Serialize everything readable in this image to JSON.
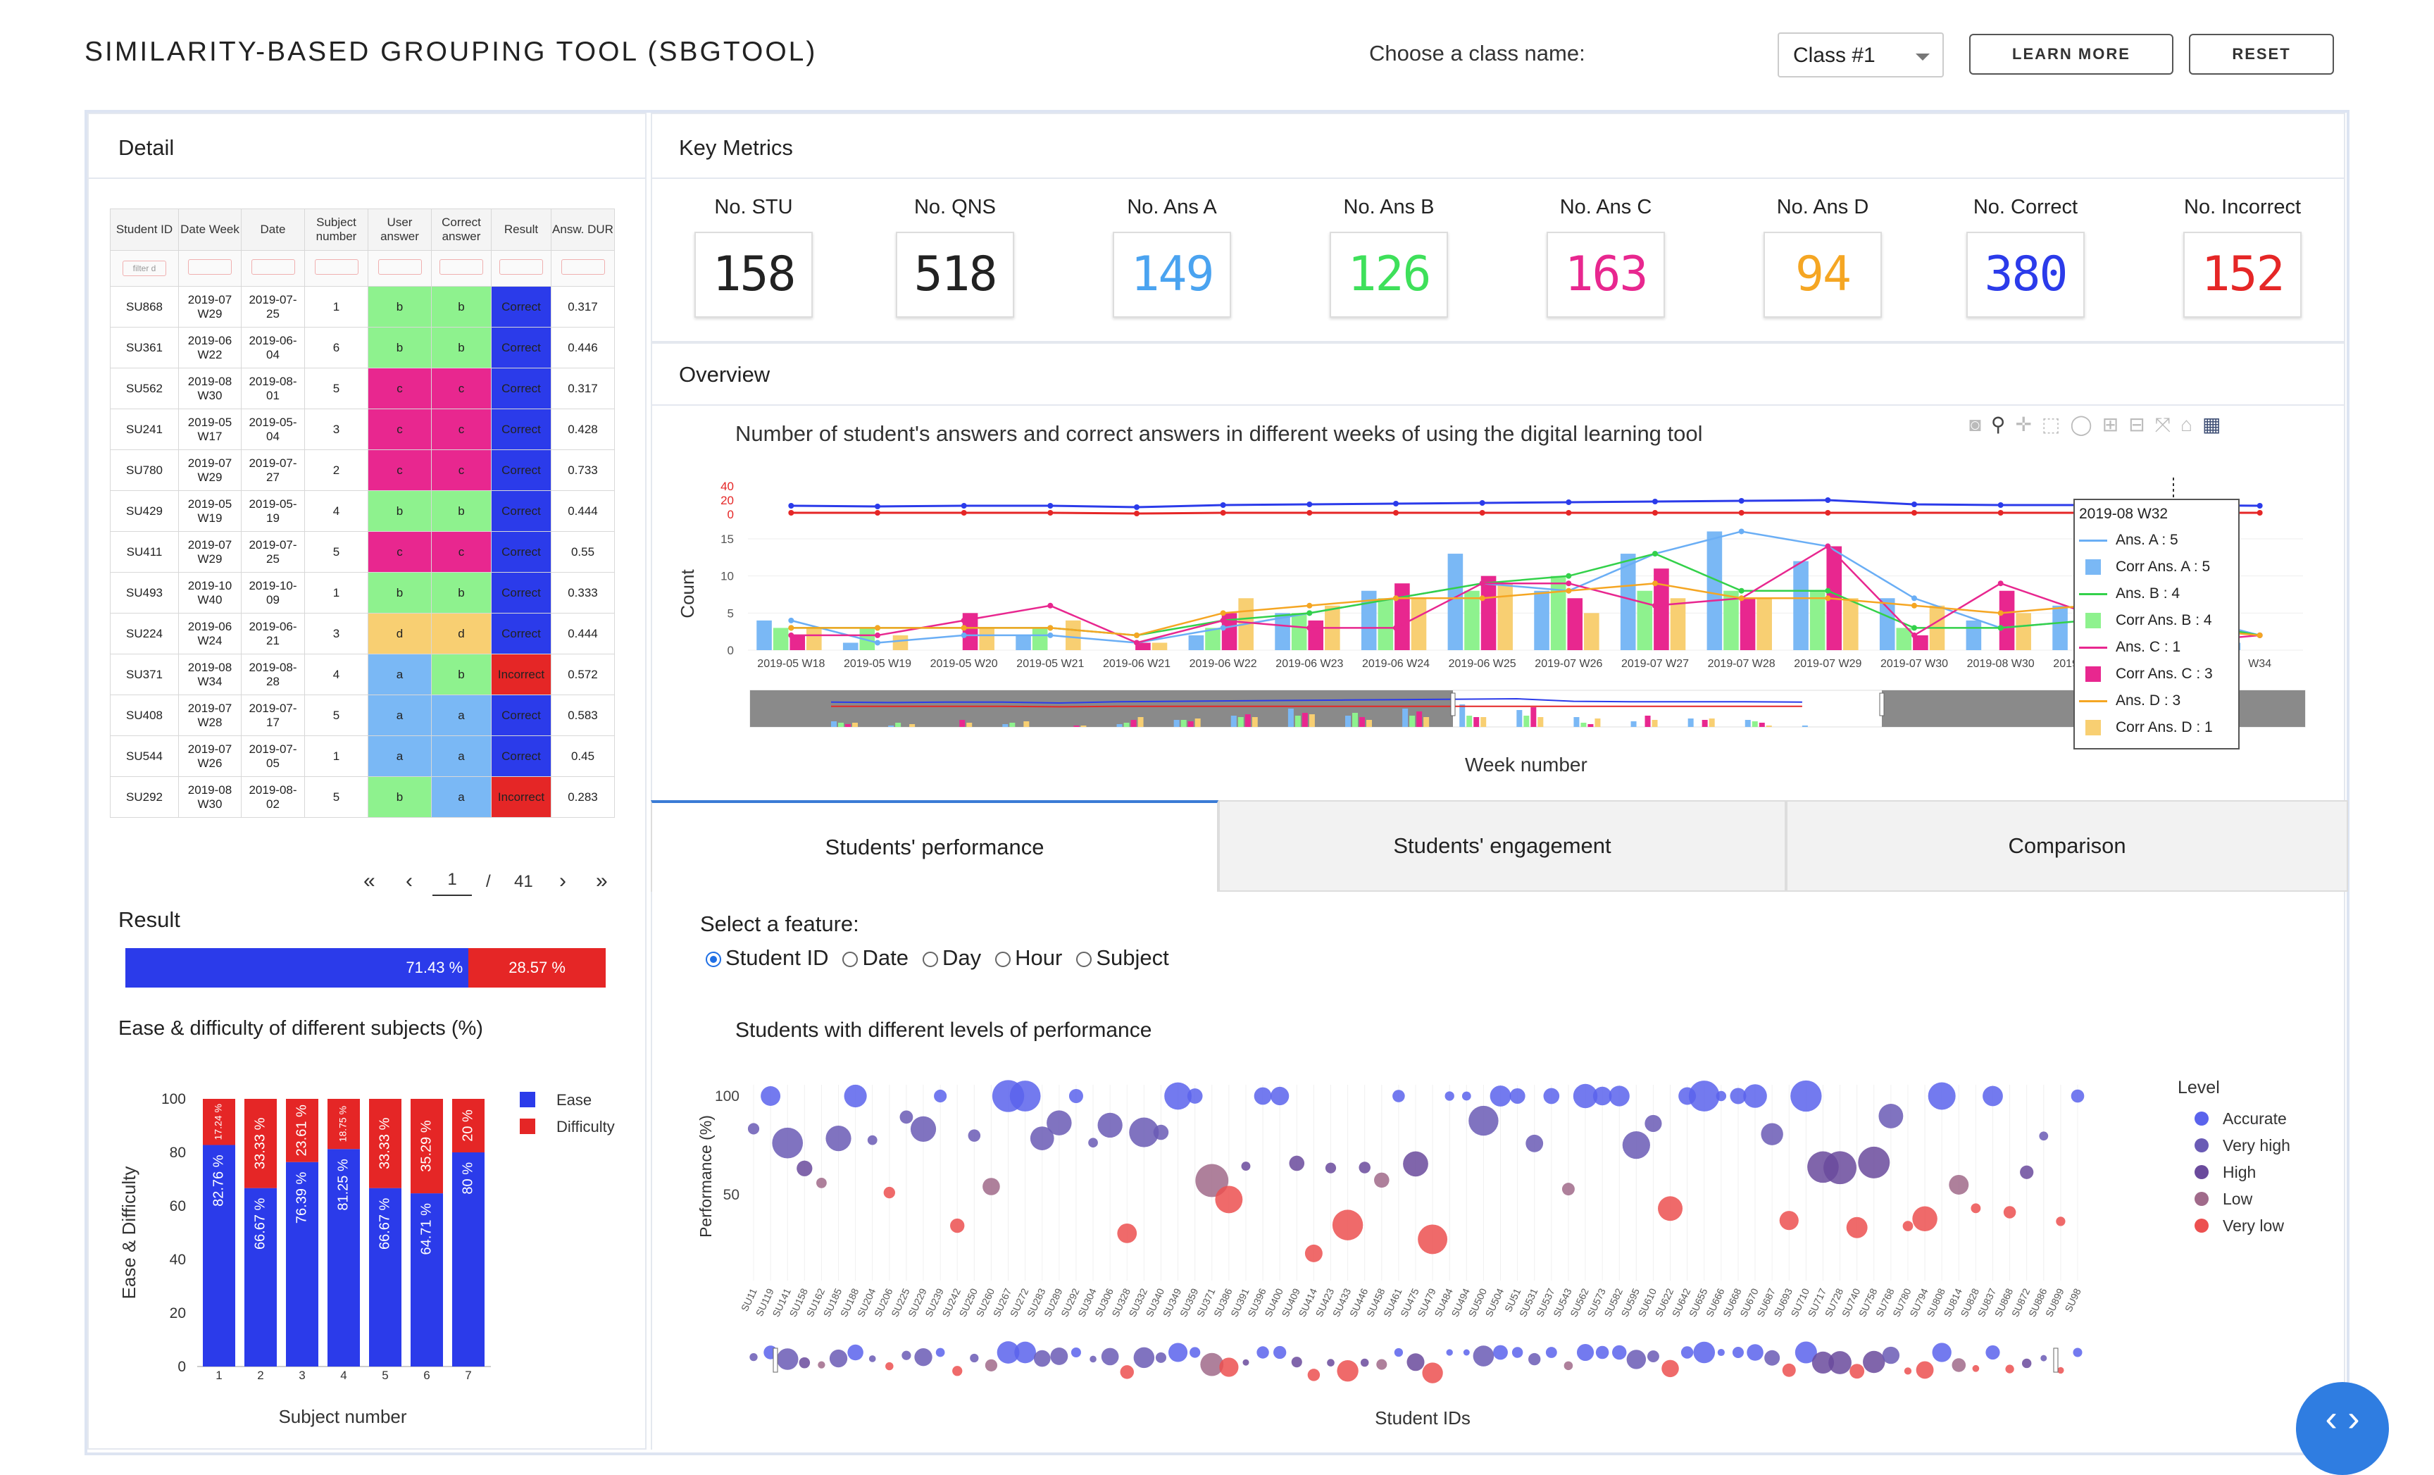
{
  "header": {
    "title": "SIMILARITY-BASED GROUPING TOOL (SBGTOOL)",
    "choose_label": "Choose a class name:",
    "class_value": "Class #1",
    "learn_more": "LEARN MORE",
    "reset": "RESET"
  },
  "detail": {
    "title": "Detail",
    "columns": [
      "Student ID",
      "Date Week",
      "Date",
      "Subject number",
      "User answer",
      "Correct answer",
      "Result",
      "Answ. DUR"
    ],
    "filter_placeholder": "filter d",
    "rows": [
      {
        "id": "SU868",
        "week": "2019-07 W29",
        "date": "2019-07-25",
        "subj": "1",
        "user": "b",
        "correct": "b",
        "result": "Correct",
        "dur": "0.317"
      },
      {
        "id": "SU361",
        "week": "2019-06 W22",
        "date": "2019-06-04",
        "subj": "6",
        "user": "b",
        "correct": "b",
        "result": "Correct",
        "dur": "0.446"
      },
      {
        "id": "SU562",
        "week": "2019-08 W30",
        "date": "2019-08-01",
        "subj": "5",
        "user": "c",
        "correct": "c",
        "result": "Correct",
        "dur": "0.317"
      },
      {
        "id": "SU241",
        "week": "2019-05 W17",
        "date": "2019-05-04",
        "subj": "3",
        "user": "c",
        "correct": "c",
        "result": "Correct",
        "dur": "0.428"
      },
      {
        "id": "SU780",
        "week": "2019-07 W29",
        "date": "2019-07-27",
        "subj": "2",
        "user": "c",
        "correct": "c",
        "result": "Correct",
        "dur": "0.733"
      },
      {
        "id": "SU429",
        "week": "2019-05 W19",
        "date": "2019-05-19",
        "subj": "4",
        "user": "b",
        "correct": "b",
        "result": "Correct",
        "dur": "0.444"
      },
      {
        "id": "SU411",
        "week": "2019-07 W29",
        "date": "2019-07-25",
        "subj": "5",
        "user": "c",
        "correct": "c",
        "result": "Correct",
        "dur": "0.55"
      },
      {
        "id": "SU493",
        "week": "2019-10 W40",
        "date": "2019-10-09",
        "subj": "1",
        "user": "b",
        "correct": "b",
        "result": "Correct",
        "dur": "0.333"
      },
      {
        "id": "SU224",
        "week": "2019-06 W24",
        "date": "2019-06-21",
        "subj": "3",
        "user": "d",
        "correct": "d",
        "result": "Correct",
        "dur": "0.444"
      },
      {
        "id": "SU371",
        "week": "2019-08 W34",
        "date": "2019-08-28",
        "subj": "4",
        "user": "a",
        "correct": "b",
        "result": "Incorrect",
        "dur": "0.572"
      },
      {
        "id": "SU408",
        "week": "2019-07 W28",
        "date": "2019-07-17",
        "subj": "5",
        "user": "a",
        "correct": "a",
        "result": "Correct",
        "dur": "0.583"
      },
      {
        "id": "SU544",
        "week": "2019-07 W26",
        "date": "2019-07-05",
        "subj": "1",
        "user": "a",
        "correct": "a",
        "result": "Correct",
        "dur": "0.45"
      },
      {
        "id": "SU292",
        "week": "2019-08 W30",
        "date": "2019-08-02",
        "subj": "5",
        "user": "b",
        "correct": "a",
        "result": "Incorrect",
        "dur": "0.283"
      }
    ],
    "pager": {
      "first": "«",
      "prev": "‹",
      "page": "1",
      "sep": "/",
      "total": "41",
      "next": "›",
      "last": "»"
    }
  },
  "result": {
    "title": "Result",
    "correct_pct": "71.43 %",
    "incorrect_pct": "28.57 %",
    "correct_fraction": 0.7143
  },
  "colors": {
    "correct": "#2b3bea",
    "incorrect": "#e52626",
    "ans_a": "#6aaef5",
    "ans_b": "#33d14a",
    "ans_c": "#e8278f",
    "ans_d": "#f5a623",
    "corr_a": "#7ab8f5",
    "corr_b": "#8ef28e",
    "corr_c": "#e8278f",
    "corr_d": "#f8cf72"
  },
  "metrics": {
    "title": "Key Metrics",
    "items": [
      {
        "label": "No. STU",
        "value": "158",
        "color": "#222222"
      },
      {
        "label": "No. QNS",
        "value": "518",
        "color": "#222222"
      },
      {
        "label": "No. Ans A",
        "value": "149",
        "color": "#4aa3f0"
      },
      {
        "label": "No. Ans B",
        "value": "126",
        "color": "#3ee05a"
      },
      {
        "label": "No. Ans C",
        "value": "163",
        "color": "#e8278f"
      },
      {
        "label": "No. Ans D",
        "value": "94",
        "color": "#f5a623"
      },
      {
        "label": "No. Correct",
        "value": "380",
        "color": "#2b3bea"
      },
      {
        "label": "No. Incorrect",
        "value": "152",
        "color": "#e52626"
      }
    ]
  },
  "overview": {
    "title": "Overview",
    "week_axis_label": "Week number",
    "tooltip": {
      "title": "2019-08 W32",
      "entries": [
        "Ans. A : 5",
        "Corr Ans. A : 5",
        "Ans. B : 4",
        "Corr Ans. B : 4",
        "Ans. C : 1",
        "Corr Ans. C : 3",
        "Ans. D : 3",
        "Corr Ans. D : 1"
      ]
    }
  },
  "tabs": [
    "Students' performance",
    "Students' engagement",
    "Comparison"
  ],
  "feature": {
    "label": "Select a feature:",
    "options": [
      "Student ID",
      "Date",
      "Day",
      "Hour",
      "Subject"
    ],
    "selected": "Student ID"
  },
  "chart_data": [
    {
      "type": "bar",
      "title": "Ease & difficulty of different subjects (%)",
      "xlabel": "Subject number",
      "ylabel": "Ease & Difficulty",
      "ylim": [
        0,
        100
      ],
      "yticks": [
        "0",
        "20",
        "40",
        "60",
        "80",
        "100"
      ],
      "categories": [
        "1",
        "2",
        "3",
        "4",
        "5",
        "6",
        "7"
      ],
      "stacked": true,
      "legend_position": "top-right",
      "series": [
        {
          "name": "Ease",
          "color": "#2b3bea",
          "values": [
            82.76,
            66.67,
            76.39,
            81.25,
            66.67,
            64.71,
            80
          ],
          "labels": [
            "82.76 %",
            "66.67 %",
            "76.39 %",
            "81.25 %",
            "66.67 %",
            "64.71 %",
            "80 %"
          ]
        },
        {
          "name": "Difficulty",
          "color": "#e52626",
          "values": [
            17.24,
            33.33,
            23.61,
            18.75,
            33.33,
            35.29,
            20
          ],
          "labels": [
            "17.24 %",
            "33.33 %",
            "23.61 %",
            "18.75 %",
            "33.33 %",
            "35.29 %",
            "20 %"
          ]
        }
      ]
    },
    {
      "type": "bar",
      "title": "Number of student's answers and correct answers in different weeks of using the digital learning tool",
      "xlabel": "Week number",
      "ylabel": "Count",
      "ylim": [
        0,
        15
      ],
      "yticks": [
        "0",
        "5",
        "10",
        "15"
      ],
      "upper_yticks": [
        "0",
        "20",
        "40"
      ],
      "categories": [
        "2019-05 W18",
        "2019-05 W19",
        "2019-05 W20",
        "2019-05 W21",
        "2019-06 W21",
        "2019-06 W22",
        "2019-06 W23",
        "2019-06 W24",
        "2019-06 W25",
        "2019-07 W26",
        "2019-07 W27",
        "2019-07 W28",
        "2019-07 W29",
        "2019-07 W30",
        "2019-08 W30",
        "2019-08 W31",
        "2019-08 W32",
        "2019-08 W34"
      ],
      "tick_labels": [
        "2019-05 W18",
        "2019-05 W19",
        "2019-05 W20",
        "2019-05 W21",
        "2019-06 W21",
        "2019-06 W22",
        "2019-06 W23",
        "2019-06 W24",
        "2019-06 W25",
        "2019-07 W26",
        "2019-07 W27",
        "2019-07 W28",
        "2019-07 W29",
        "2019-07 W30",
        "2019-08 W30",
        "2019-08 W31",
        "2019-08",
        "W34"
      ],
      "bar_series": [
        {
          "name": "Corr Ans. A",
          "color": "#7ab8f5",
          "values": [
            4,
            1,
            0,
            2,
            0,
            2,
            5,
            8,
            13,
            8,
            13,
            16,
            12,
            7,
            4,
            6,
            5,
            1
          ]
        },
        {
          "name": "Corr Ans. B",
          "color": "#8ef28e",
          "values": [
            3,
            3,
            0,
            3,
            0,
            3,
            5,
            7,
            8,
            10,
            8,
            8,
            8,
            3,
            0,
            0,
            4,
            0
          ]
        },
        {
          "name": "Corr Ans. C",
          "color": "#e8278f",
          "values": [
            2,
            0,
            5,
            0,
            1,
            5,
            4,
            9,
            10,
            7,
            11,
            7,
            14,
            2,
            8,
            5,
            3,
            0
          ]
        },
        {
          "name": "Corr Ans. D",
          "color": "#f8cf72",
          "values": [
            3,
            2,
            3,
            4,
            1,
            7,
            6,
            7,
            9,
            5,
            7,
            7,
            7,
            6,
            5,
            6,
            1,
            0
          ]
        }
      ],
      "line_series": [
        {
          "name": "Ans. A",
          "color": "#6aaef5",
          "values": [
            4,
            1,
            2,
            2,
            1,
            3,
            5,
            7,
            9,
            8,
            13,
            16,
            14,
            7,
            3,
            4,
            5,
            2
          ]
        },
        {
          "name": "Ans. B",
          "color": "#33d14a",
          "values": [
            3,
            3,
            3,
            3,
            2,
            4,
            5,
            7,
            9,
            10,
            13,
            8,
            8,
            3,
            3,
            4,
            4,
            2
          ]
        },
        {
          "name": "Ans. C",
          "color": "#e8278f",
          "values": [
            2,
            2,
            4,
            6,
            1,
            4,
            3,
            3,
            9,
            9,
            6,
            7,
            14,
            2,
            9,
            5,
            1,
            2
          ]
        },
        {
          "name": "Ans. D",
          "color": "#f5a623",
          "values": [
            3,
            3,
            3,
            3,
            2,
            5,
            6,
            7,
            7,
            8,
            9,
            7,
            7,
            6,
            5,
            6,
            3,
            2
          ]
        }
      ],
      "upper_series": [
        {
          "name": "Correct",
          "color": "#2b3bea",
          "values": [
            12,
            11,
            12,
            12,
            10,
            13,
            14,
            15,
            16,
            17,
            18,
            19,
            20,
            14,
            13,
            13,
            13,
            12
          ]
        },
        {
          "name": "Incorrect",
          "color": "#e52626",
          "values": [
            2,
            2,
            2,
            2,
            1,
            2,
            2,
            2,
            2,
            2,
            2,
            2,
            2,
            2,
            2,
            2,
            2,
            2
          ]
        }
      ]
    },
    {
      "type": "scatter",
      "title": "Students with different levels of performance",
      "xlabel": "Student IDs",
      "ylabel": "Performance (%)",
      "yticks": [
        "50",
        "100"
      ],
      "legend_title": "Level",
      "legend": [
        {
          "name": "Accurate",
          "color": "#5a63ec"
        },
        {
          "name": "Very high",
          "color": "#6a5bb5"
        },
        {
          "name": "High",
          "color": "#6a4a9c"
        },
        {
          "name": "Low",
          "color": "#a06a8a"
        },
        {
          "name": "Very low",
          "color": "#ec5050"
        }
      ],
      "x_labels": [
        "SU11",
        "SU119",
        "SU141",
        "SU158",
        "SU162",
        "SU185",
        "SU188",
        "SU204",
        "SU206",
        "SU225",
        "SU229",
        "SU239",
        "SU242",
        "SU250",
        "SU260",
        "SU267",
        "SU272",
        "SU283",
        "SU289",
        "SU292",
        "SU304",
        "SU306",
        "SU328",
        "SU332",
        "SU340",
        "SU349",
        "SU359",
        "SU371",
        "SU386",
        "SU391",
        "SU396",
        "SU400",
        "SU409",
        "SU414",
        "SU423",
        "SU433",
        "SU446",
        "SU458",
        "SU461",
        "SU475",
        "SU479",
        "SU484",
        "SU494",
        "SU500",
        "SU504",
        "SU51",
        "SU531",
        "SU537",
        "SU543",
        "SU562",
        "SU573",
        "SU582",
        "SU595",
        "SU610",
        "SU622",
        "SU642",
        "SU655",
        "SU666",
        "SU668",
        "SU670",
        "SU687",
        "SU693",
        "SU710",
        "SU717",
        "SU728",
        "SU740",
        "SU758",
        "SU768",
        "SU780",
        "SU794",
        "SU808",
        "SU814",
        "SU828",
        "SU837",
        "SU868",
        "SU872",
        "SU886",
        "SU899",
        "SU98"
      ]
    }
  ]
}
